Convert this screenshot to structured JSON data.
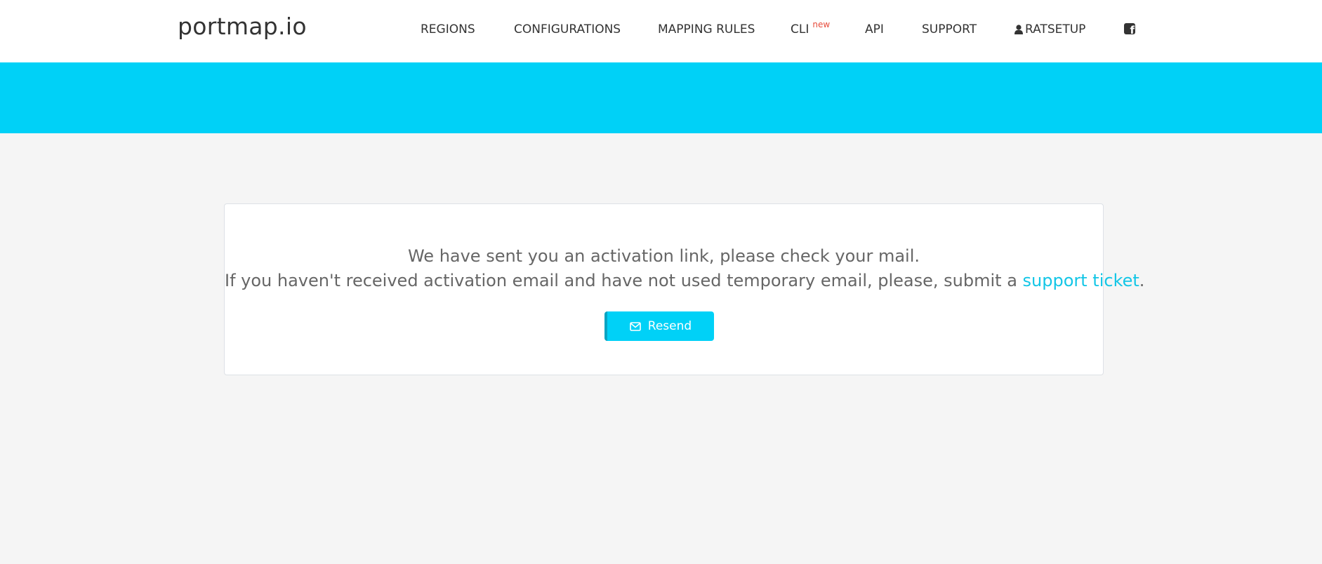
{
  "brand": {
    "name": "portmap.io"
  },
  "nav": {
    "regions": "REGIONS",
    "configurations": "CONFIGURATIONS",
    "mapping_rules": "MAPPING RULES",
    "cli": "CLI",
    "cli_badge": "new",
    "api": "API",
    "support": "SUPPORT",
    "user": "RATSETUP",
    "facebook_icon": "facebook-square-icon"
  },
  "colors": {
    "accent": "#00d1f7",
    "link": "#13c6e6",
    "badge": "#e74c3c",
    "page_bg": "#f5f5f5"
  },
  "message": {
    "line1": "We have sent you an activation link, please check your mail.",
    "line2_prefix": "If you haven't received activation email and have not used temporary email, please, submit a ",
    "line2_link": "support ticket",
    "line2_suffix": "."
  },
  "resend": {
    "label": "Resend",
    "icon": "envelope-icon"
  }
}
